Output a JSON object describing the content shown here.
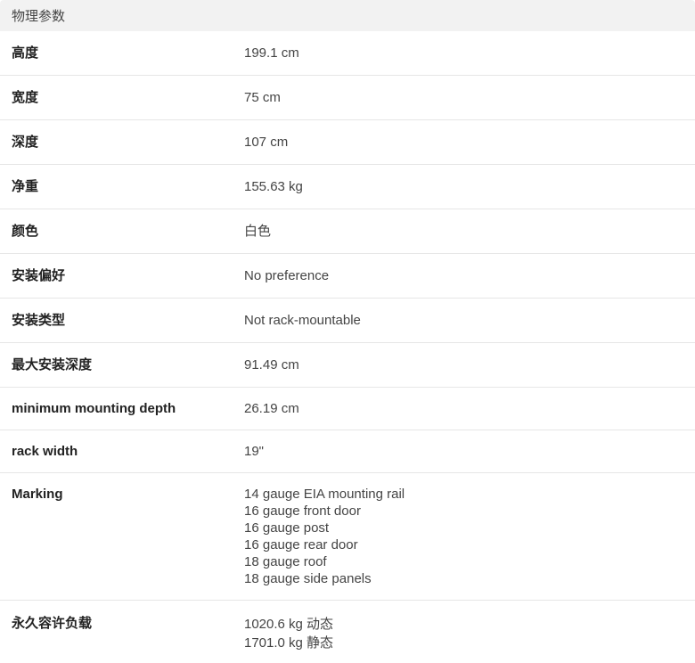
{
  "section": {
    "title": "物理参数"
  },
  "rows": [
    {
      "label": "高度",
      "values": [
        "199.1 cm"
      ]
    },
    {
      "label": "宽度",
      "values": [
        "75 cm"
      ]
    },
    {
      "label": "深度",
      "values": [
        "107 cm"
      ]
    },
    {
      "label": "净重",
      "values": [
        "155.63 kg"
      ]
    },
    {
      "label": "颜色",
      "values": [
        "白色"
      ]
    },
    {
      "label": "安装偏好",
      "values": [
        "No preference"
      ]
    },
    {
      "label": "安装类型",
      "values": [
        "Not rack-mountable"
      ]
    },
    {
      "label": "最大安装深度",
      "values": [
        "91.49 cm"
      ]
    },
    {
      "label": "minimum mounting depth",
      "values": [
        "26.19 cm"
      ]
    },
    {
      "label": "rack width",
      "values": [
        "19\""
      ]
    },
    {
      "label": "Marking",
      "values": [
        "14 gauge EIA mounting rail",
        "16 gauge front door",
        "16 gauge post",
        "16 gauge rear door",
        "18 gauge roof",
        "18 gauge side panels"
      ]
    },
    {
      "label": "永久容许负载",
      "values": [
        "1020.6 kg 动态",
        "1701.0 kg 静态"
      ]
    }
  ]
}
